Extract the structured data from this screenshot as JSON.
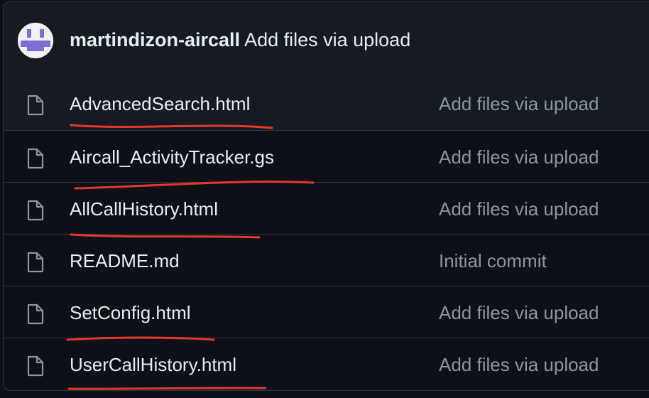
{
  "commit": {
    "author": "martindizon-aircall",
    "message": "Add files via upload"
  },
  "files": [
    {
      "name": "AdvancedSearch.html",
      "commit_message": "Add files via upload",
      "icon": "file-icon"
    },
    {
      "name": "Aircall_ActivityTracker.gs",
      "commit_message": "Add files via upload",
      "icon": "file-icon"
    },
    {
      "name": "AllCallHistory.html",
      "commit_message": "Add files via upload",
      "icon": "file-icon"
    },
    {
      "name": "README.md",
      "commit_message": "Initial commit",
      "icon": "file-icon"
    },
    {
      "name": "SetConfig.html",
      "commit_message": "Add files via upload",
      "icon": "file-icon"
    },
    {
      "name": "UserCallHistory.html",
      "commit_message": "Add files via upload",
      "icon": "file-icon"
    }
  ],
  "colors": {
    "background": "#0d1117",
    "header_background": "#161b22",
    "border": "#30363d",
    "text": "#e6edf3",
    "muted_text": "#8d96a0",
    "annotation": "#e5382a",
    "avatar_accent": "#7b6fd6"
  }
}
